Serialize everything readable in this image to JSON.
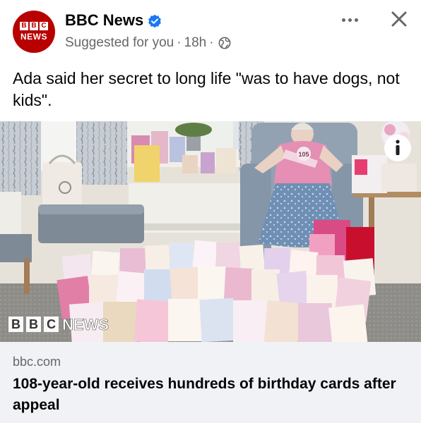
{
  "post": {
    "page_name": "BBC News",
    "avatar": {
      "blocks": [
        "B",
        "B",
        "C"
      ],
      "word": "NEWS"
    },
    "meta": {
      "suggested": "Suggested for you",
      "separator": "·",
      "time": "18h"
    },
    "caption": "Ada said her secret to long life \"was to have dogs, not kids\"."
  },
  "photo": {
    "watermark_blocks": [
      "B",
      "B",
      "C"
    ],
    "watermark_word": "NEWS",
    "badge_number": "105"
  },
  "link_preview": {
    "domain": "bbc.com",
    "headline": "108-year-old receives hundreds of birthday cards after appeal"
  },
  "colors": {
    "bbc_red": "#b80000",
    "verified_blue": "#1877f2",
    "secondary_text": "#65676b",
    "preview_background": "#f0f2f5"
  },
  "icons": [
    "verified-badge-icon",
    "globe-icon",
    "more-options-icon",
    "close-icon",
    "info-icon"
  ]
}
